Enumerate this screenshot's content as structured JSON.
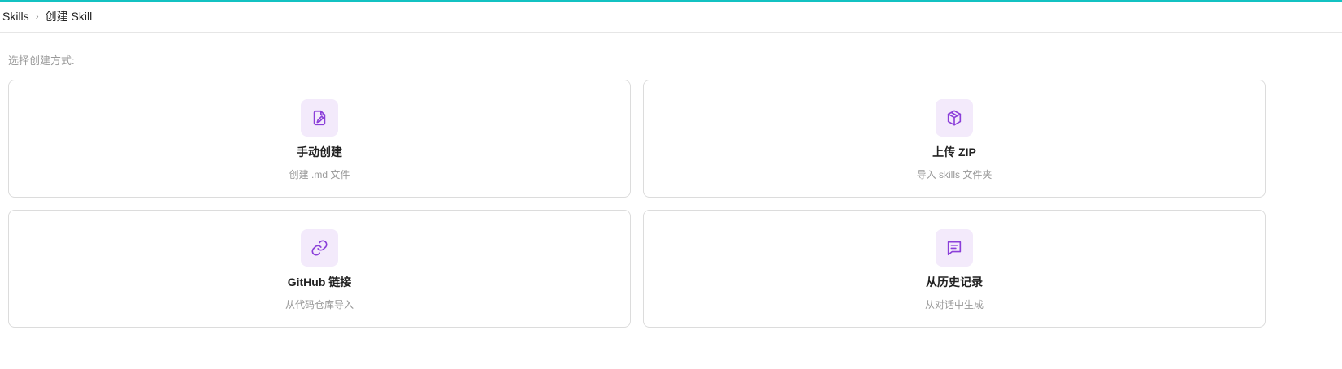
{
  "breadcrumb": {
    "root": "Skills",
    "separator": "›",
    "current": "创建 Skill"
  },
  "section_label": "选择创建方式:",
  "accent_color": "#13c2c2",
  "icon_color": "#8b3fd9",
  "cards": [
    {
      "icon": "file-edit-icon",
      "title": "手动创建",
      "desc": "创建 .md 文件"
    },
    {
      "icon": "package-icon",
      "title": "上传 ZIP",
      "desc": "导入 skills 文件夹"
    },
    {
      "icon": "link-icon",
      "title": "GitHub 链接",
      "desc": "从代码仓库导入"
    },
    {
      "icon": "message-icon",
      "title": "从历史记录",
      "desc": "从对话中生成"
    }
  ]
}
